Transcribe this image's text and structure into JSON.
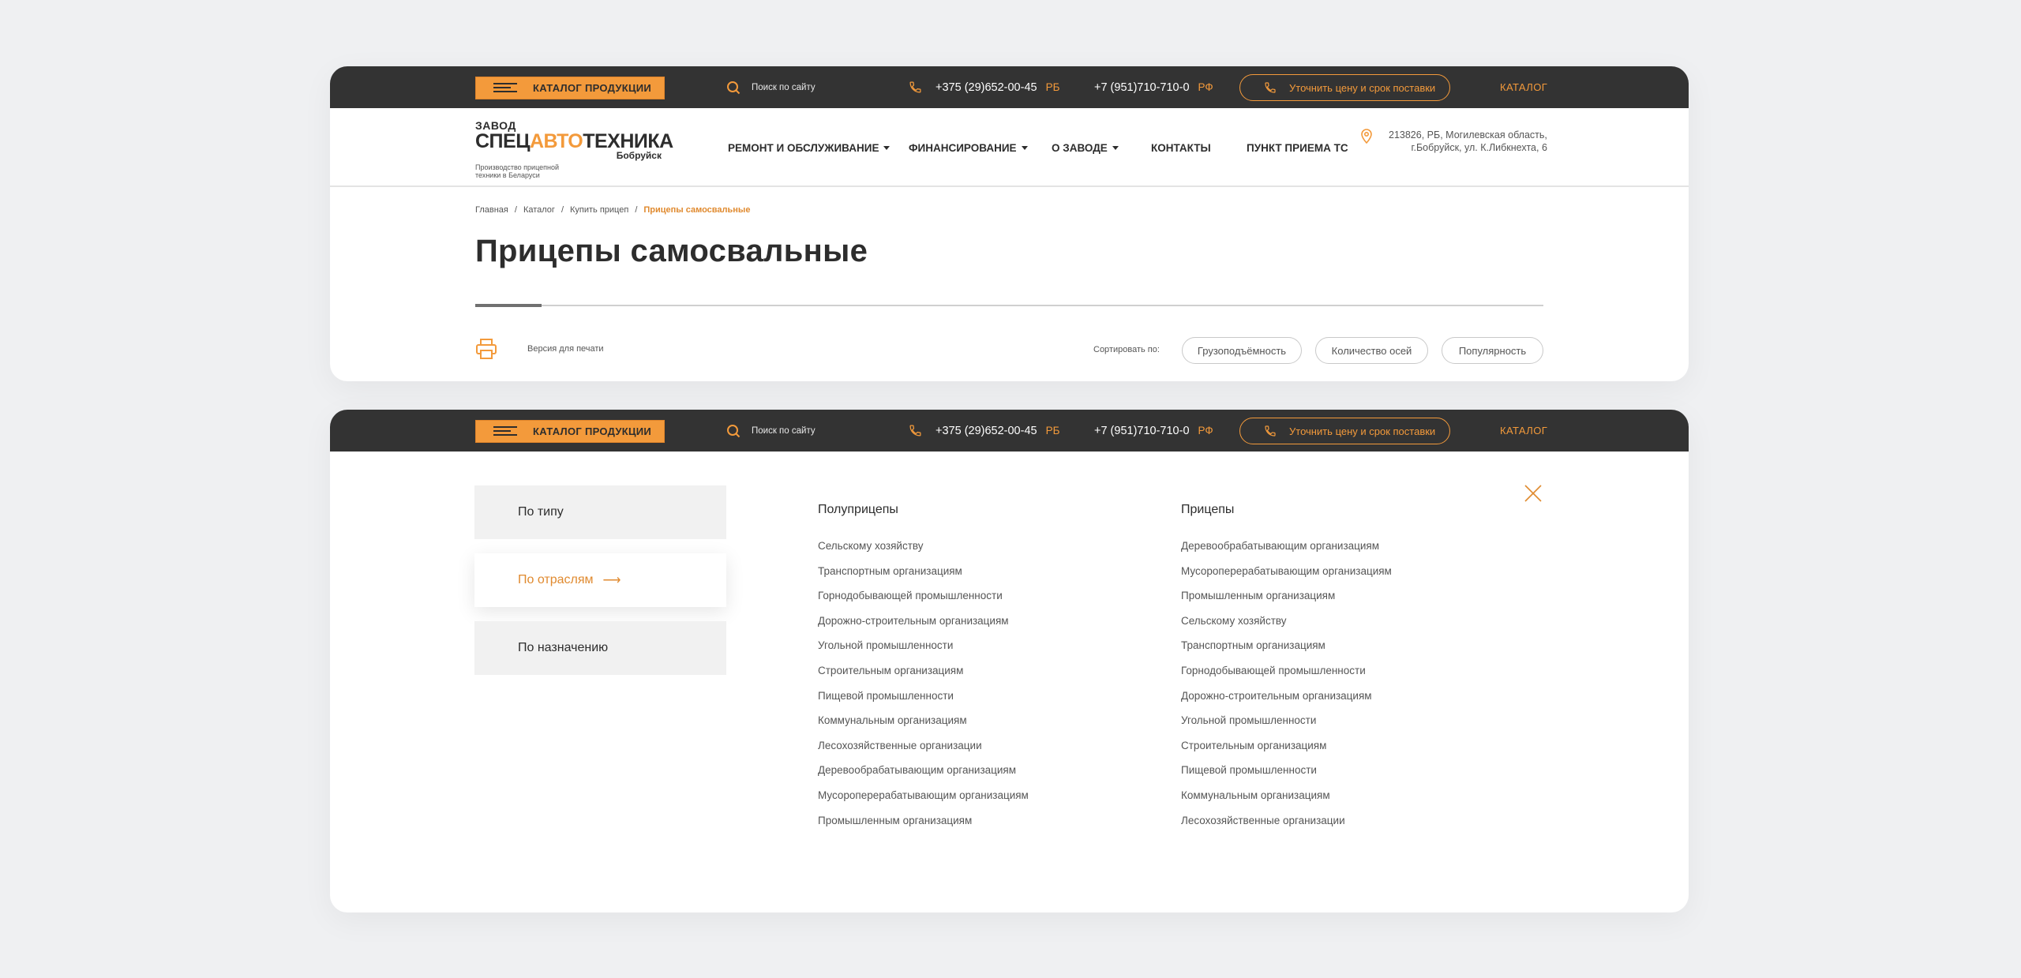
{
  "topbar": {
    "catalog_button": "КАТАЛОГ ПРОДУКЦИИ",
    "search_placeholder": "Поиск по сайту",
    "phone_by": "+375 (29)652-00-45",
    "phone_by_country": "РБ",
    "phone_ru": "+7 (951)710-710-0",
    "phone_ru_country": "РФ",
    "clarify_button": "Уточнить цену и срок поставки",
    "catalog_link": "КАТАЛОГ"
  },
  "header": {
    "logo": {
      "line1": "ЗАВОД",
      "line2_a": "СПЕЦ",
      "line2_b": "АВТО",
      "line2_c": "ТЕХНИКА",
      "line3": "Бобруйск",
      "tagline": "Производство прицепной техники в Беларуси"
    },
    "nav": [
      {
        "label": "РЕМОНТ И ОБСЛУЖИВАНИЕ"
      },
      {
        "label": "ФИНАНСИРОВАНИЕ"
      },
      {
        "label": "О ЗАВОДЕ"
      },
      {
        "label": "КОНТАКТЫ"
      },
      {
        "label": "ПУНКТ ПРИЕМА ТС"
      }
    ],
    "address_line1": "213826, РБ, Могилевская область,",
    "address_line2": "г.Бобруйск, ул. К.Либкнехта, 6"
  },
  "breadcrumbs": [
    "Главная",
    "Каталог",
    "Купить прицеп",
    "Прицепы самосвальные"
  ],
  "page_title": "Прицепы самосвальные",
  "print_label": "Версия для печати",
  "sort": {
    "label": "Сортировать по:",
    "options": [
      "Грузоподъёмность",
      "Количество осей",
      "Популярность"
    ]
  },
  "colors": {
    "accent": "#f39a3b",
    "dark": "#333333",
    "background": "#eff0f2"
  },
  "catalog_menu": {
    "sidebar": [
      "По типу",
      "По отраслям",
      "По назначению"
    ],
    "active_index": 1,
    "active_arrow": "⟶",
    "columns": [
      {
        "title": "Полуприцепы",
        "links": [
          "Сельскому хозяйству",
          "Транспортным организациям",
          "Горнодобывающей промышленности",
          "Дорожно-строительным организациям",
          "Угольной промышленности",
          "Строительным организациям",
          "Пищевой промышленности",
          "Коммунальным организациям",
          "Лесохозяйственные организации",
          "Деревообрабатывающим организациям",
          "Мусороперерабатывающим организациям",
          "Промышленным организациям"
        ]
      },
      {
        "title": "Прицепы",
        "links": [
          "Деревообрабатывающим организациям",
          "Мусороперерабатывающим организациям",
          "Промышленным организациям",
          "Сельскому хозяйству",
          "Транспортным организациям",
          "Горнодобывающей промышленности",
          "Дорожно-строительным организациям",
          "Угольной промышленности",
          "Строительным организациям",
          "Пищевой промышленности",
          "Коммунальным организациям",
          "Лесохозяйственные организации"
        ]
      }
    ]
  }
}
